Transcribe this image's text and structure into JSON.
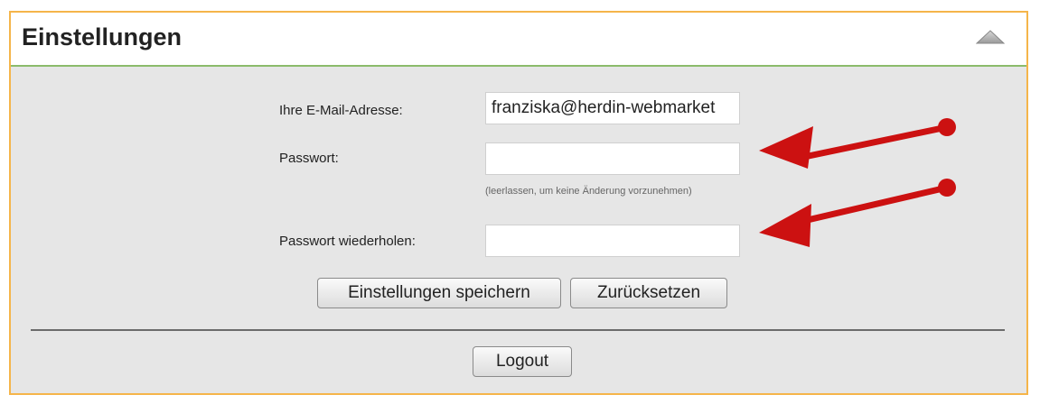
{
  "panel": {
    "title": "Einstellungen",
    "border_color": "#f5b54a",
    "header_underline_color": "#8bbb6b",
    "collapse_icon": "triangle-up-icon"
  },
  "form": {
    "email_label": "Ihre E-Mail-Adresse:",
    "email_value": "franziska@herdin-webmarket",
    "password_label": "Passwort:",
    "password_value": "",
    "password_hint": "(leerlassen, um keine Änderung vorzunehmen)",
    "password_repeat_label": "Passwort wiederholen:",
    "password_repeat_value": ""
  },
  "buttons": {
    "save_label": "Einstellungen speichern",
    "reset_label": "Zurücksetzen",
    "logout_label": "Logout"
  },
  "annotations": {
    "arrow_color": "#cc1111"
  }
}
